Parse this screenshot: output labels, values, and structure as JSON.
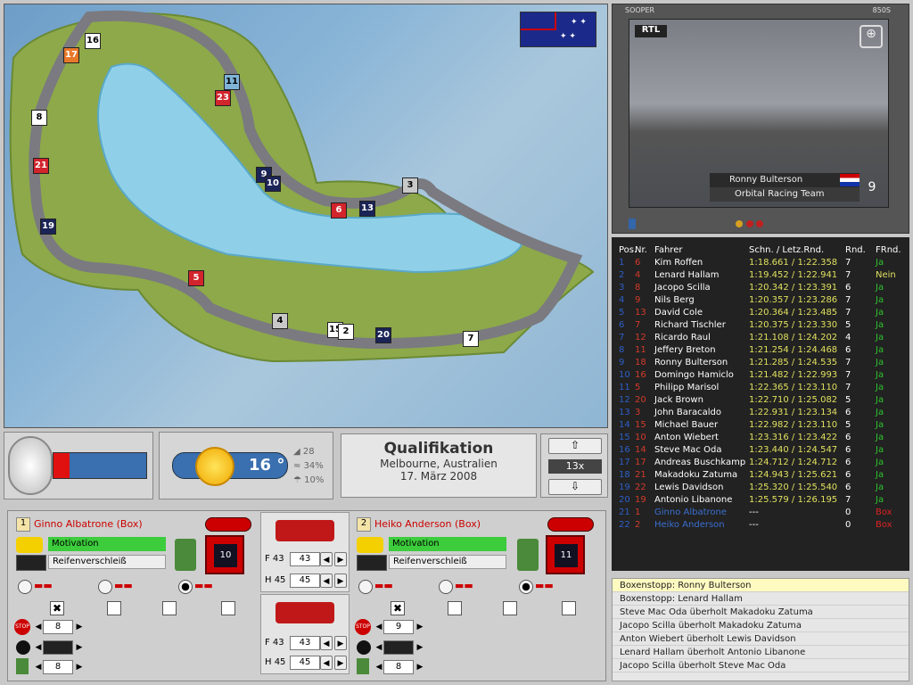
{
  "track": {
    "markers": [
      {
        "n": "16",
        "c": "w"
      },
      {
        "n": "17",
        "c": "o"
      },
      {
        "n": "11",
        "c": "b"
      },
      {
        "n": "23",
        "c": "r"
      },
      {
        "n": "8",
        "c": "w"
      },
      {
        "n": "21",
        "c": "r"
      },
      {
        "n": "9",
        "c": "n"
      },
      {
        "n": "10",
        "c": "n"
      },
      {
        "n": "19",
        "c": "n"
      },
      {
        "n": "3",
        "c": "g"
      },
      {
        "n": "6",
        "c": "r"
      },
      {
        "n": "13",
        "c": "n"
      },
      {
        "n": "5",
        "c": "r"
      },
      {
        "n": "4",
        "c": "g"
      },
      {
        "n": "15",
        "c": "w"
      },
      {
        "n": "2",
        "c": "w"
      },
      {
        "n": "20",
        "c": "n"
      },
      {
        "n": "7",
        "c": "w"
      }
    ]
  },
  "tv": {
    "header_left": "SOOPER",
    "header_right": "850S",
    "logo": "RTL",
    "driver": "Ronny Bulterson",
    "team": "Orbital Racing Team",
    "position": "9"
  },
  "timing": {
    "headers": {
      "pos": "Pos.",
      "nr": "Nr.",
      "driver": "Fahrer",
      "laps": "Schn. / Letz.Rnd.",
      "rnd": "Rnd.",
      "frnd": "FRnd."
    },
    "rows": [
      {
        "pos": "1",
        "nr": "6",
        "driver": "Kim Roffen",
        "time": "1:18.661 / 1:22.358",
        "rnd": "7",
        "fr": "Ja"
      },
      {
        "pos": "2",
        "nr": "4",
        "driver": "Lenard Hallam",
        "time": "1:19.452 / 1:22.941",
        "rnd": "7",
        "fr": "Nein"
      },
      {
        "pos": "3",
        "nr": "8",
        "driver": "Jacopo Scilla",
        "time": "1:20.342 / 1:23.391",
        "rnd": "6",
        "fr": "Ja"
      },
      {
        "pos": "4",
        "nr": "9",
        "driver": "Nils Berg",
        "time": "1:20.357 / 1:23.286",
        "rnd": "7",
        "fr": "Ja"
      },
      {
        "pos": "5",
        "nr": "13",
        "driver": "David Cole",
        "time": "1:20.364 / 1:23.485",
        "rnd": "7",
        "fr": "Ja"
      },
      {
        "pos": "6",
        "nr": "7",
        "driver": "Richard Tischler",
        "time": "1:20.375 / 1:23.330",
        "rnd": "5",
        "fr": "Ja"
      },
      {
        "pos": "7",
        "nr": "12",
        "driver": "Ricardo Raul",
        "time": "1:21.108 / 1:24.202",
        "rnd": "4",
        "fr": "Ja"
      },
      {
        "pos": "8",
        "nr": "11",
        "driver": "Jeffery Breton",
        "time": "1:21.254 / 1:24.468",
        "rnd": "6",
        "fr": "Ja"
      },
      {
        "pos": "9",
        "nr": "18",
        "driver": "Ronny Bulterson",
        "time": "1:21.285 / 1:24.535",
        "rnd": "7",
        "fr": "Ja"
      },
      {
        "pos": "10",
        "nr": "16",
        "driver": "Domingo Hamiclo",
        "time": "1:21.482 / 1:22.993",
        "rnd": "7",
        "fr": "Ja"
      },
      {
        "pos": "11",
        "nr": "5",
        "driver": "Philipp Marisol",
        "time": "1:22.365 / 1:23.110",
        "rnd": "7",
        "fr": "Ja"
      },
      {
        "pos": "12",
        "nr": "20",
        "driver": "Jack Brown",
        "time": "1:22.710 / 1:25.082",
        "rnd": "5",
        "fr": "Ja"
      },
      {
        "pos": "13",
        "nr": "3",
        "driver": "John Baracaldo",
        "time": "1:22.931 / 1:23.134",
        "rnd": "6",
        "fr": "Ja"
      },
      {
        "pos": "14",
        "nr": "15",
        "driver": "Michael Bauer",
        "time": "1:22.982 / 1:23.110",
        "rnd": "5",
        "fr": "Ja"
      },
      {
        "pos": "15",
        "nr": "10",
        "driver": "Anton Wiebert",
        "time": "1:23.316 / 1:23.422",
        "rnd": "6",
        "fr": "Ja"
      },
      {
        "pos": "16",
        "nr": "14",
        "driver": "Steve Mac Oda",
        "time": "1:23.440 / 1:24.547",
        "rnd": "6",
        "fr": "Ja"
      },
      {
        "pos": "17",
        "nr": "17",
        "driver": "Andreas Buschkamp",
        "time": "1:24.712 / 1:24.712",
        "rnd": "6",
        "fr": "Ja"
      },
      {
        "pos": "18",
        "nr": "21",
        "driver": "Makadoku Zatuma",
        "time": "1:24.943 / 1:25.621",
        "rnd": "6",
        "fr": "Ja"
      },
      {
        "pos": "19",
        "nr": "22",
        "driver": "Lewis Davidson",
        "time": "1:25.320 / 1:25.540",
        "rnd": "6",
        "fr": "Ja"
      },
      {
        "pos": "20",
        "nr": "19",
        "driver": "Antonio Libanone",
        "time": "1:25.579 / 1:26.195",
        "rnd": "7",
        "fr": "Ja"
      },
      {
        "pos": "21",
        "nr": "1",
        "driver": "Ginno Albatrone",
        "time": "---",
        "rnd": "0",
        "fr": "Box"
      },
      {
        "pos": "22",
        "nr": "2",
        "driver": "Heiko Anderson",
        "time": "---",
        "rnd": "0",
        "fr": "Box"
      }
    ]
  },
  "status": {
    "weather_temp": "16 °",
    "wind": "28",
    "humidity": "34%",
    "rain": "10%",
    "session_title": "Qualifikation",
    "location": "Melbourne, Australien",
    "date": "17. März 2008",
    "speed": "13x"
  },
  "driver1": {
    "num": "1",
    "name": "Ginno Albatrone (Box)",
    "motivation": "Motivation",
    "tyres": "Reifenverschleiß",
    "fuel": "10",
    "stop": "8",
    "tyre_count": "8"
  },
  "driver2": {
    "num": "2",
    "name": "Heiko Anderson (Box)",
    "motivation": "Motivation",
    "tyres": "Reifenverschleiß",
    "fuel": "11",
    "stop": "9",
    "tyre_count": "8"
  },
  "wings": {
    "f_label": "F 43",
    "f_val": "43",
    "h_label": "H 45",
    "h_val": "45"
  },
  "events": [
    "Boxenstopp: Ronny Bulterson",
    "Boxenstopp: Lenard Hallam",
    "Steve Mac Oda überholt Makadoku Zatuma",
    "Jacopo Scilla überholt Makadoku Zatuma",
    "Anton Wiebert überholt Lewis Davidson",
    "Lenard Hallam überholt Antonio Libanone",
    "Jacopo Scilla überholt Steve Mac Oda"
  ]
}
